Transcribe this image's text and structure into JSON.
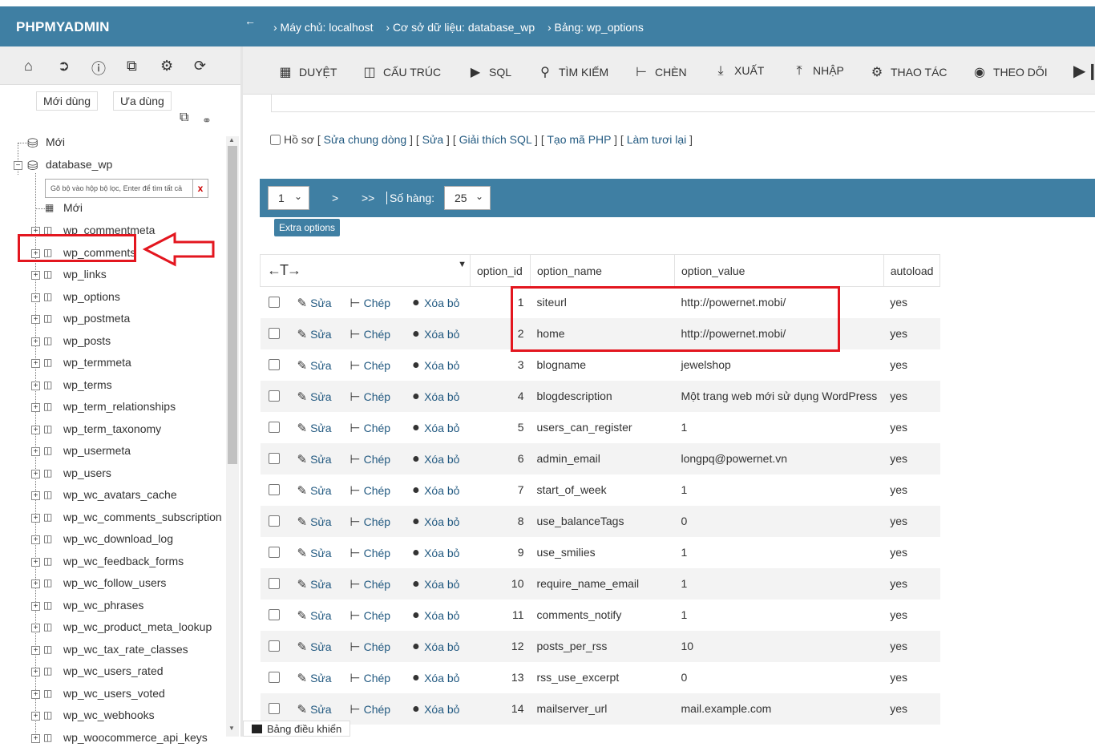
{
  "app": {
    "logo": "PHPMYADMIN"
  },
  "breadcrumb": {
    "back_icon": "arrow-left-icon",
    "server": "› Máy chủ: localhost",
    "database": "› Cơ sở dữ liệu: database_wp",
    "table": "› Bảng: wp_options"
  },
  "sidebar": {
    "icons": [
      "home-icon",
      "logout-icon",
      "info-icon",
      "docs-icon",
      "gear-icon",
      "reload-icon"
    ],
    "recent_label": "Mới dùng",
    "favorites_label": "Ưa dùng",
    "new_root": "Mới",
    "database": "database_wp",
    "filter_placeholder": "Gõ bộ vào hộp bộ lọc, Enter để tìm tất cả",
    "filter_clear": "x",
    "new_table": "Mới",
    "tables": [
      "wp_commentmeta",
      "wp_comments",
      "wp_links",
      "wp_options",
      "wp_postmeta",
      "wp_posts",
      "wp_termmeta",
      "wp_terms",
      "wp_term_relationships",
      "wp_term_taxonomy",
      "wp_usermeta",
      "wp_users",
      "wp_wc_avatars_cache",
      "wp_wc_comments_subscription",
      "wp_wc_download_log",
      "wp_wc_feedback_forms",
      "wp_wc_follow_users",
      "wp_wc_phrases",
      "wp_wc_product_meta_lookup",
      "wp_wc_tax_rate_classes",
      "wp_wc_users_rated",
      "wp_wc_users_voted",
      "wp_wc_webhooks",
      "wp_woocommerce_api_keys"
    ]
  },
  "tabs": [
    {
      "label": "DUYỆT",
      "icon": "browse-icon"
    },
    {
      "label": "CẤU TRÚC",
      "icon": "structure-icon"
    },
    {
      "label": "SQL",
      "icon": "sql-icon"
    },
    {
      "label": "TÌM KIẾM",
      "icon": "search-icon"
    },
    {
      "label": "CHÈN",
      "icon": "insert-icon"
    },
    {
      "label": "XUẤT",
      "icon": "export-icon"
    },
    {
      "label": "NHẬP",
      "icon": "import-icon"
    },
    {
      "label": "THAO TÁC",
      "icon": "operations-icon"
    },
    {
      "label": "THEO DÕI",
      "icon": "tracking-icon"
    }
  ],
  "query_links": {
    "profile": "Hồ sơ",
    "links": [
      "Sửa chung dòng",
      "Sửa",
      "Giải thích SQL",
      "Tạo mã PHP",
      "Làm tươi lại"
    ]
  },
  "pager": {
    "page": "1",
    "next": ">",
    "last": ">>",
    "rows_label": "Số hàng:",
    "rows_value": "25",
    "extra_options": "Extra options"
  },
  "table": {
    "columns": [
      "option_id",
      "option_name",
      "option_value",
      "autoload"
    ],
    "actions": {
      "edit": "Sửa",
      "copy": "Chép",
      "delete": "Xóa bỏ"
    },
    "rows": [
      {
        "id": "1",
        "name": "siteurl",
        "value": "http://powernet.mobi/",
        "autoload": "yes"
      },
      {
        "id": "2",
        "name": "home",
        "value": "http://powernet.mobi/",
        "autoload": "yes"
      },
      {
        "id": "3",
        "name": "blogname",
        "value": "jewelshop",
        "autoload": "yes"
      },
      {
        "id": "4",
        "name": "blogdescription",
        "value": "Một trang web mới sử dụng WordPress",
        "autoload": "yes"
      },
      {
        "id": "5",
        "name": "users_can_register",
        "value": "1",
        "autoload": "yes"
      },
      {
        "id": "6",
        "name": "admin_email",
        "value": "longpq@powernet.vn",
        "autoload": "yes"
      },
      {
        "id": "7",
        "name": "start_of_week",
        "value": "1",
        "autoload": "yes"
      },
      {
        "id": "8",
        "name": "use_balanceTags",
        "value": "0",
        "autoload": "yes"
      },
      {
        "id": "9",
        "name": "use_smilies",
        "value": "1",
        "autoload": "yes"
      },
      {
        "id": "10",
        "name": "require_name_email",
        "value": "1",
        "autoload": "yes"
      },
      {
        "id": "11",
        "name": "comments_notify",
        "value": "1",
        "autoload": "yes"
      },
      {
        "id": "12",
        "name": "posts_per_rss",
        "value": "10",
        "autoload": "yes"
      },
      {
        "id": "13",
        "name": "rss_use_excerpt",
        "value": "0",
        "autoload": "yes"
      },
      {
        "id": "14",
        "name": "mailserver_url",
        "value": "mail.example.com",
        "autoload": "yes"
      }
    ]
  },
  "console": {
    "label": "Bảng điều khiển"
  },
  "colors": {
    "header": "#3f7fa3",
    "highlight": "#e3161f",
    "link": "#235a81"
  }
}
